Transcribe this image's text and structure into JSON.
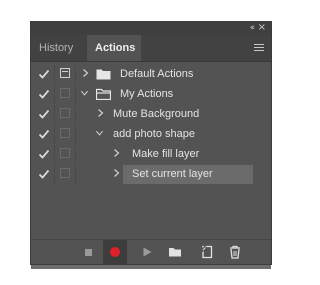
{
  "panel": {
    "tabs": [
      {
        "label": "History",
        "active": false
      },
      {
        "label": "Actions",
        "active": true
      }
    ],
    "collapse_glyph": "‹‹",
    "close_glyph": "×"
  },
  "actions": [
    {
      "label": "Default Actions",
      "type": "set",
      "expanded": false,
      "checked": true,
      "dialog_toggle": true
    },
    {
      "label": "My Actions",
      "type": "set",
      "expanded": true,
      "checked": true,
      "dialog_toggle": false
    },
    {
      "label": "Mute Background",
      "type": "action",
      "expanded": false,
      "checked": true,
      "dialog_toggle": false
    },
    {
      "label": "add photo shape",
      "type": "action",
      "expanded": true,
      "checked": true,
      "dialog_toggle": false
    },
    {
      "label": "Make fill layer",
      "type": "step",
      "expanded": false,
      "checked": true,
      "dialog_toggle": false
    },
    {
      "label": "Set current layer",
      "type": "step",
      "expanded": false,
      "checked": true,
      "dialog_toggle": false,
      "selected": true
    }
  ],
  "bottom_toolbar": {
    "buttons": [
      "stop-icon",
      "record-icon",
      "play-icon",
      "folder-icon",
      "new-action-icon",
      "trash-icon"
    ],
    "record_color": "#e0202a"
  }
}
